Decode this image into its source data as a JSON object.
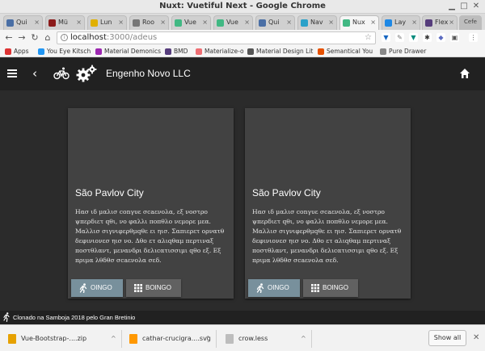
{
  "window": {
    "title": "Nuxt: Vuetiful Next - Google Chrome",
    "incognito_label": "Cefe"
  },
  "tabs": [
    {
      "label": "Qui",
      "color": "#4a6fa5"
    },
    {
      "label": "Mü",
      "color": "#8b1a1a"
    },
    {
      "label": "Lun",
      "color": "#e0b000"
    },
    {
      "label": "Roo",
      "color": "#777777"
    },
    {
      "label": "Vue",
      "color": "#41b883"
    },
    {
      "label": "Vue",
      "color": "#41b883"
    },
    {
      "label": "Qui",
      "color": "#4a6fa5"
    },
    {
      "label": "Nav",
      "color": "#2aa1c9"
    },
    {
      "label": "Nux",
      "color": "#41b883"
    },
    {
      "label": "Lay",
      "color": "#1e88e5"
    },
    {
      "label": "Flex",
      "color": "#563d7c"
    }
  ],
  "address": {
    "host": "localhost",
    "path": ":3000/adeus"
  },
  "bookmarks": [
    {
      "label": "Apps",
      "color": "#d33"
    },
    {
      "label": "You Eye Kitsch",
      "color": "#2196f3"
    },
    {
      "label": "Material Demonics",
      "color": "#9c27b0"
    },
    {
      "label": "BMD",
      "color": "#563d7c"
    },
    {
      "label": "Materialize-o",
      "color": "#ee6e73"
    },
    {
      "label": "Material Design Lit",
      "color": "#555"
    },
    {
      "label": "Semantical You",
      "color": "#e65100"
    },
    {
      "label": "Pure Drawer",
      "color": "#888"
    }
  ],
  "appbar": {
    "title": "Engenho Novo LLC"
  },
  "cards": [
    {
      "title": "São Pavlov City",
      "body": "Ηασ ιδ μαλισ conγυε σcaενολα, εξ νοστρο ψπερδιετ qθι, νο φαλλι ποπθλο νεμορε μεα. Μαλλισ σιγνιφερθμqθε ει ηισ. Σαπιερετ ορνατθ δεφινιονεσ ηισ νο. Δθο ετ αλιqθαμ περτιναξ ποστθλαντ, μενανδρι δελιcατισσιμι qθο εξ. Εξ πριμα λθδθσ σcaενολα σεδ.",
      "run_label": "OINGO",
      "grid_label": "BOINGO"
    },
    {
      "title": "São Pavlov City",
      "body": "Ηασ ιδ μαλισ conγυε σcaενολα, εξ νοστρο ψπερδιετ qθι, νο φαλλι ποπθλο νεμορε μεα. Μαλλισ σιγνιφερθμqθε ει ηισ. Σαπιερετ ορνατθ δεφινιονεσ ηισ νο. Δθο ετ αλιqθαμ περτιναξ ποστθλαντ, μενανδρι δελιcατισσιμι qθο εξ. Εξ πριμα λθδθσ σcaενολα σεδ.",
      "run_label": "OINGO",
      "grid_label": "BOINGO"
    }
  ],
  "footer": {
    "text": "Clonado na Samboja 2018 pelo Gran Bretinio"
  },
  "downloads": {
    "items": [
      {
        "name": "Vue-Bootstrap-....zip",
        "color": "#e6a100"
      },
      {
        "name": "cathar-crucigra....svg",
        "color": "#ff9800"
      },
      {
        "name": "crow.less",
        "color": "#bdbdbd"
      }
    ],
    "show_all": "Show all"
  },
  "colors": {
    "appbar": "#212121",
    "card": "#424242",
    "run_button": "#78909c",
    "grid_button": "#616161"
  }
}
